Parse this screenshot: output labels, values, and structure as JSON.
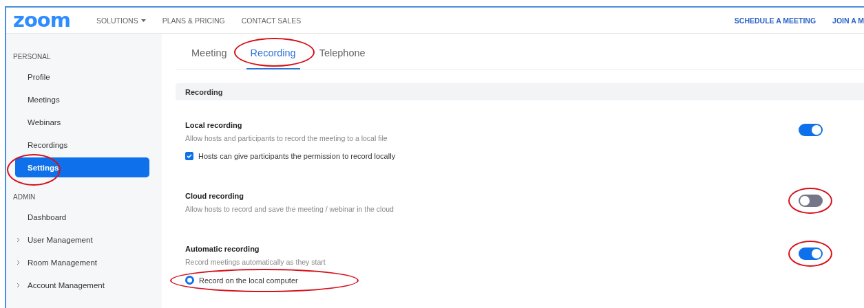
{
  "nav": {
    "logo": "zoom",
    "left_links": [
      {
        "label": "SOLUTIONS",
        "dropdown": true
      },
      {
        "label": "PLANS & PRICING",
        "dropdown": false
      },
      {
        "label": "CONTACT SALES",
        "dropdown": false
      }
    ],
    "right_links": [
      "SCHEDULE A MEETING",
      "JOIN A M"
    ]
  },
  "sidebar": {
    "sections": [
      {
        "heading": "PERSONAL",
        "items": [
          {
            "label": "Profile",
            "selected": false,
            "expandable": false,
            "circled": false
          },
          {
            "label": "Meetings",
            "selected": false,
            "expandable": false,
            "circled": false
          },
          {
            "label": "Webinars",
            "selected": false,
            "expandable": false,
            "circled": false
          },
          {
            "label": "Recordings",
            "selected": false,
            "expandable": false,
            "circled": false
          },
          {
            "label": "Settings",
            "selected": true,
            "expandable": false,
            "circled": true
          }
        ]
      },
      {
        "heading": "ADMIN",
        "items": [
          {
            "label": "Dashboard",
            "selected": false,
            "expandable": false,
            "circled": false
          },
          {
            "label": "User Management",
            "selected": false,
            "expandable": true,
            "circled": false
          },
          {
            "label": "Room Management",
            "selected": false,
            "expandable": true,
            "circled": false
          },
          {
            "label": "Account Management",
            "selected": false,
            "expandable": true,
            "circled": false
          }
        ]
      }
    ]
  },
  "tabs": [
    {
      "label": "Meeting",
      "selected": false,
      "circled": false
    },
    {
      "label": "Recording",
      "selected": true,
      "circled": true
    },
    {
      "label": "Telephone",
      "selected": false,
      "circled": false
    }
  ],
  "section_header": "Recording",
  "settings": [
    {
      "title": "Local recording",
      "description": "Allow hosts and participants to record the meeting to a local file",
      "on": true,
      "circled": false,
      "options": [
        {
          "kind": "checkbox",
          "label": "Hosts can give participants the permission to record locally",
          "checked": true,
          "circled": false
        }
      ]
    },
    {
      "title": "Cloud recording",
      "description": "Allow hosts to record and save the meeting / webinar in the cloud",
      "on": false,
      "circled": true
    },
    {
      "title": "Automatic recording",
      "description": "Record meetings automatically as they start",
      "on": true,
      "circled": true,
      "options": [
        {
          "kind": "radio",
          "label": "Record on the local computer",
          "checked": true,
          "circled": true
        }
      ]
    }
  ]
}
